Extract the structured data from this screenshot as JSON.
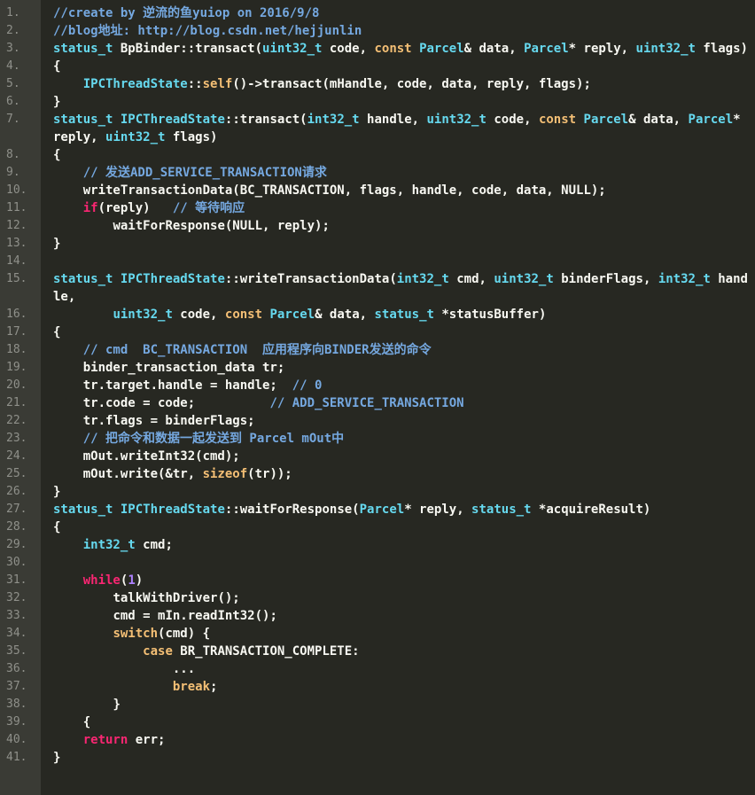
{
  "colors": {
    "background": "#272822",
    "gutter": "#3a3b35",
    "line_number": "#8f908a",
    "plain": "#f8f8f2",
    "type": "#66d9ef",
    "keyword": "#f92672",
    "control": "#f4bf75",
    "comment": "#75a8e0",
    "number": "#ae81ff"
  },
  "lines": [
    {
      "n": "1.",
      "tokens": [
        {
          "t": "    //create by 逆流的鱼yuiop on 2016/9/8",
          "c": "cm"
        }
      ]
    },
    {
      "n": "2.",
      "tokens": [
        {
          "t": "    //blog地址: http://blog.csdn.net/hejjunlin",
          "c": "cm"
        }
      ]
    },
    {
      "n": "3.",
      "tokens": [
        {
          "t": "    status_t",
          "c": "type"
        },
        {
          "t": " BpBinder::transact(",
          "c": "plain"
        },
        {
          "t": "uint32_t",
          "c": "type"
        },
        {
          "t": " code, ",
          "c": "plain"
        },
        {
          "t": "const",
          "c": "ctl"
        },
        {
          "t": " ",
          "c": "plain"
        },
        {
          "t": "Parcel",
          "c": "type"
        },
        {
          "t": "& data, ",
          "c": "plain"
        },
        {
          "t": "Parcel",
          "c": "type"
        },
        {
          "t": "* reply, ",
          "c": "plain"
        },
        {
          "t": "uint32_t",
          "c": "type"
        },
        {
          "t": " flags)",
          "c": "plain"
        }
      ]
    },
    {
      "n": "4.",
      "tokens": [
        {
          "t": "    {",
          "c": "plain"
        }
      ]
    },
    {
      "n": "5.",
      "tokens": [
        {
          "t": "        IPCThreadState",
          "c": "type"
        },
        {
          "t": "::",
          "c": "plain"
        },
        {
          "t": "self",
          "c": "ctl"
        },
        {
          "t": "()->transact(mHandle, code, data, reply, flags);",
          "c": "plain"
        }
      ]
    },
    {
      "n": "6.",
      "tokens": [
        {
          "t": "    }",
          "c": "plain"
        }
      ]
    },
    {
      "n": "7.",
      "tokens": [
        {
          "t": "    status_t",
          "c": "type"
        },
        {
          "t": " ",
          "c": "plain"
        },
        {
          "t": "IPCThreadState",
          "c": "type"
        },
        {
          "t": "::transact(",
          "c": "plain"
        },
        {
          "t": "int32_t",
          "c": "type"
        },
        {
          "t": " handle, ",
          "c": "plain"
        },
        {
          "t": "uint32_t",
          "c": "type"
        },
        {
          "t": " code, ",
          "c": "plain"
        },
        {
          "t": "const",
          "c": "ctl"
        },
        {
          "t": " ",
          "c": "plain"
        },
        {
          "t": "Parcel",
          "c": "type"
        },
        {
          "t": "& data, ",
          "c": "plain"
        },
        {
          "t": "Parcel",
          "c": "type"
        },
        {
          "t": "* reply, ",
          "c": "plain"
        },
        {
          "t": "uint32_t",
          "c": "type"
        },
        {
          "t": " flags)",
          "c": "plain"
        }
      ]
    },
    {
      "n": "8.",
      "tokens": [
        {
          "t": "    {",
          "c": "plain"
        }
      ]
    },
    {
      "n": "9.",
      "tokens": [
        {
          "t": "        // 发送ADD_SERVICE_TRANSACTION请求",
          "c": "cm"
        }
      ]
    },
    {
      "n": "10.",
      "tokens": [
        {
          "t": "        writeTransactionData(BC_TRANSACTION, flags, handle, code, data, NULL);",
          "c": "plain"
        }
      ]
    },
    {
      "n": "11.",
      "tokens": [
        {
          "t": "        ",
          "c": "plain"
        },
        {
          "t": "if",
          "c": "kw"
        },
        {
          "t": "(reply)   ",
          "c": "plain"
        },
        {
          "t": "// 等待响应",
          "c": "cm"
        }
      ]
    },
    {
      "n": "12.",
      "tokens": [
        {
          "t": "            waitForResponse(NULL, reply);",
          "c": "plain"
        }
      ]
    },
    {
      "n": "13.",
      "tokens": [
        {
          "t": "    }",
          "c": "plain"
        }
      ]
    },
    {
      "n": "14.",
      "tokens": []
    },
    {
      "n": "15.",
      "tokens": [
        {
          "t": "    status_t",
          "c": "type"
        },
        {
          "t": " ",
          "c": "plain"
        },
        {
          "t": "IPCThreadState",
          "c": "type"
        },
        {
          "t": "::writeTransactionData(",
          "c": "plain"
        },
        {
          "t": "int32_t",
          "c": "type"
        },
        {
          "t": " cmd, ",
          "c": "plain"
        },
        {
          "t": "uint32_t",
          "c": "type"
        },
        {
          "t": " binderFlags, ",
          "c": "plain"
        },
        {
          "t": "int32_t",
          "c": "type"
        },
        {
          "t": " handle,",
          "c": "plain"
        }
      ]
    },
    {
      "n": "16.",
      "tokens": [
        {
          "t": "            ",
          "c": "plain"
        },
        {
          "t": "uint32_t",
          "c": "type"
        },
        {
          "t": " code, ",
          "c": "plain"
        },
        {
          "t": "const",
          "c": "ctl"
        },
        {
          "t": " ",
          "c": "plain"
        },
        {
          "t": "Parcel",
          "c": "type"
        },
        {
          "t": "& data, ",
          "c": "plain"
        },
        {
          "t": "status_t",
          "c": "type"
        },
        {
          "t": " *statusBuffer)",
          "c": "plain"
        }
      ]
    },
    {
      "n": "17.",
      "tokens": [
        {
          "t": "    {",
          "c": "plain"
        }
      ]
    },
    {
      "n": "18.",
      "tokens": [
        {
          "t": "        // cmd  BC_TRANSACTION  应用程序向BINDER发送的命令",
          "c": "cm"
        }
      ]
    },
    {
      "n": "19.",
      "tokens": [
        {
          "t": "        binder_transaction_data tr;",
          "c": "plain"
        }
      ]
    },
    {
      "n": "20.",
      "tokens": [
        {
          "t": "        tr.target.handle = handle;  ",
          "c": "plain"
        },
        {
          "t": "// 0",
          "c": "cm"
        }
      ]
    },
    {
      "n": "21.",
      "tokens": [
        {
          "t": "        tr.code = code;          ",
          "c": "plain"
        },
        {
          "t": "// ADD_SERVICE_TRANSACTION",
          "c": "cm"
        }
      ]
    },
    {
      "n": "22.",
      "tokens": [
        {
          "t": "        tr.flags = binderFlags;",
          "c": "plain"
        }
      ]
    },
    {
      "n": "23.",
      "tokens": [
        {
          "t": "        // 把命令和数据一起发送到 Parcel mOut中",
          "c": "cm"
        }
      ]
    },
    {
      "n": "24.",
      "tokens": [
        {
          "t": "        mOut.writeInt32(cmd);",
          "c": "plain"
        }
      ]
    },
    {
      "n": "25.",
      "tokens": [
        {
          "t": "        mOut.write(&tr, ",
          "c": "plain"
        },
        {
          "t": "sizeof",
          "c": "ctl"
        },
        {
          "t": "(tr));",
          "c": "plain"
        }
      ]
    },
    {
      "n": "26.",
      "tokens": [
        {
          "t": "    }",
          "c": "plain"
        }
      ]
    },
    {
      "n": "27.",
      "tokens": [
        {
          "t": "    status_t",
          "c": "type"
        },
        {
          "t": " ",
          "c": "plain"
        },
        {
          "t": "IPCThreadState",
          "c": "type"
        },
        {
          "t": "::waitForResponse(",
          "c": "plain"
        },
        {
          "t": "Parcel",
          "c": "type"
        },
        {
          "t": "* reply, ",
          "c": "plain"
        },
        {
          "t": "status_t",
          "c": "type"
        },
        {
          "t": " *acquireResult)",
          "c": "plain"
        }
      ]
    },
    {
      "n": "28.",
      "tokens": [
        {
          "t": "    {",
          "c": "plain"
        }
      ]
    },
    {
      "n": "29.",
      "tokens": [
        {
          "t": "        ",
          "c": "plain"
        },
        {
          "t": "int32_t",
          "c": "type"
        },
        {
          "t": " cmd;",
          "c": "plain"
        }
      ]
    },
    {
      "n": "30.",
      "tokens": []
    },
    {
      "n": "31.",
      "tokens": [
        {
          "t": "        ",
          "c": "plain"
        },
        {
          "t": "while",
          "c": "kw"
        },
        {
          "t": "(",
          "c": "plain"
        },
        {
          "t": "1",
          "c": "num"
        },
        {
          "t": ")",
          "c": "plain"
        }
      ]
    },
    {
      "n": "32.",
      "tokens": [
        {
          "t": "            talkWithDriver();",
          "c": "plain"
        }
      ]
    },
    {
      "n": "33.",
      "tokens": [
        {
          "t": "            cmd = mIn.readInt32();",
          "c": "plain"
        }
      ]
    },
    {
      "n": "34.",
      "tokens": [
        {
          "t": "            ",
          "c": "plain"
        },
        {
          "t": "switch",
          "c": "ctl"
        },
        {
          "t": "(cmd) {",
          "c": "plain"
        }
      ]
    },
    {
      "n": "35.",
      "tokens": [
        {
          "t": "                ",
          "c": "plain"
        },
        {
          "t": "case",
          "c": "ctl"
        },
        {
          "t": " BR_TRANSACTION_COMPLETE:",
          "c": "plain"
        }
      ]
    },
    {
      "n": "36.",
      "tokens": [
        {
          "t": "                    ...",
          "c": "plain"
        }
      ]
    },
    {
      "n": "37.",
      "tokens": [
        {
          "t": "                    ",
          "c": "plain"
        },
        {
          "t": "break",
          "c": "ctl"
        },
        {
          "t": ";",
          "c": "plain"
        }
      ]
    },
    {
      "n": "38.",
      "tokens": [
        {
          "t": "            }",
          "c": "plain"
        }
      ]
    },
    {
      "n": "39.",
      "tokens": [
        {
          "t": "        {",
          "c": "plain"
        }
      ]
    },
    {
      "n": "40.",
      "tokens": [
        {
          "t": "        ",
          "c": "plain"
        },
        {
          "t": "return",
          "c": "kw"
        },
        {
          "t": " err;",
          "c": "plain"
        }
      ]
    },
    {
      "n": "41.",
      "tokens": [
        {
          "t": "    }",
          "c": "plain"
        }
      ]
    }
  ]
}
